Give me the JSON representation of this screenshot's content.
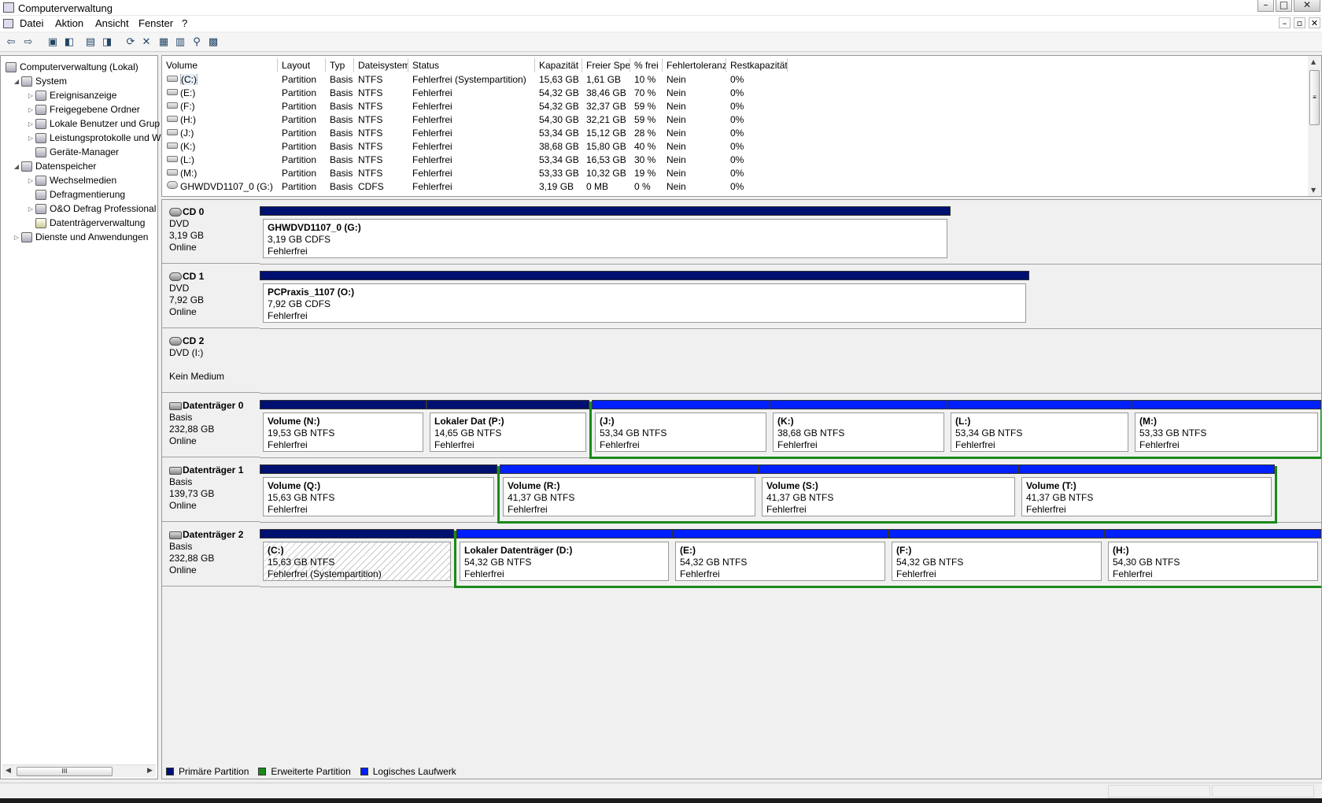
{
  "window": {
    "title": "Computerverwaltung",
    "buttons": [
      "–",
      "□",
      "✕"
    ]
  },
  "menu": {
    "items": [
      "Datei",
      "Aktion",
      "Ansicht",
      "Fenster",
      "?"
    ],
    "mdi_buttons": [
      "–",
      "▫",
      "✕"
    ]
  },
  "toolbar": {
    "buttons": [
      {
        "name": "back-icon",
        "glyph": "⇦"
      },
      {
        "name": "forward-icon",
        "glyph": "⇨"
      },
      {
        "name": "up-folder-icon",
        "glyph": "▣"
      },
      {
        "name": "show-hide-tree-icon",
        "glyph": "◧"
      },
      {
        "name": "properties-icon",
        "glyph": "▤"
      },
      {
        "name": "help-icon",
        "glyph": "◨"
      },
      {
        "name": "refresh-icon",
        "glyph": "⟳"
      },
      {
        "name": "delete-icon",
        "glyph": "✕"
      },
      {
        "name": "properties2-icon",
        "glyph": "▦"
      },
      {
        "name": "open-icon",
        "glyph": "▥"
      },
      {
        "name": "search-icon",
        "glyph": "⚲"
      },
      {
        "name": "settings-icon",
        "glyph": "▩"
      }
    ]
  },
  "tree": {
    "items": [
      {
        "label": "Computerverwaltung (Lokal)",
        "level": 0,
        "expander": ""
      },
      {
        "label": "System",
        "level": 1,
        "expander": "◢"
      },
      {
        "label": "Ereignisanzeige",
        "level": 2,
        "expander": "▷"
      },
      {
        "label": "Freigegebene Ordner",
        "level": 2,
        "expander": "▷"
      },
      {
        "label": "Lokale Benutzer und Grup",
        "level": 2,
        "expander": "▷"
      },
      {
        "label": "Leistungsprotokolle und W",
        "level": 2,
        "expander": "▷"
      },
      {
        "label": "Geräte-Manager",
        "level": 2,
        "expander": ""
      },
      {
        "label": "Datenspeicher",
        "level": 1,
        "expander": "◢"
      },
      {
        "label": "Wechselmedien",
        "level": 2,
        "expander": "▷"
      },
      {
        "label": "Defragmentierung",
        "level": 2,
        "expander": ""
      },
      {
        "label": "O&O Defrag Professional",
        "level": 2,
        "expander": "▷"
      },
      {
        "label": "Datenträgerverwaltung",
        "level": 2,
        "expander": ""
      },
      {
        "label": "Dienste und Anwendungen",
        "level": 1,
        "expander": "▷"
      }
    ],
    "scroll_thumb": "III",
    "scroll_left": "◀",
    "scroll_right": "▶"
  },
  "volumes": {
    "columns": [
      "Volume",
      "Layout",
      "Typ",
      "Dateisystem",
      "Status",
      "Kapazität",
      "Freier Speicher",
      "% frei",
      "Fehlertoleranz",
      "Restkapazität"
    ],
    "rows": [
      [
        "(C:)",
        "Partition",
        "Basis",
        "NTFS",
        "Fehlerfrei (Systempartition)",
        "15,63 GB",
        "1,61 GB",
        "10 %",
        "Nein",
        "0%"
      ],
      [
        "(E:)",
        "Partition",
        "Basis",
        "NTFS",
        "Fehlerfrei",
        "54,32 GB",
        "38,46 GB",
        "70 %",
        "Nein",
        "0%"
      ],
      [
        "(F:)",
        "Partition",
        "Basis",
        "NTFS",
        "Fehlerfrei",
        "54,32 GB",
        "32,37 GB",
        "59 %",
        "Nein",
        "0%"
      ],
      [
        "(H:)",
        "Partition",
        "Basis",
        "NTFS",
        "Fehlerfrei",
        "54,30 GB",
        "32,21 GB",
        "59 %",
        "Nein",
        "0%"
      ],
      [
        "(J:)",
        "Partition",
        "Basis",
        "NTFS",
        "Fehlerfrei",
        "53,34 GB",
        "15,12 GB",
        "28 %",
        "Nein",
        "0%"
      ],
      [
        "(K:)",
        "Partition",
        "Basis",
        "NTFS",
        "Fehlerfrei",
        "38,68 GB",
        "15,80 GB",
        "40 %",
        "Nein",
        "0%"
      ],
      [
        "(L:)",
        "Partition",
        "Basis",
        "NTFS",
        "Fehlerfrei",
        "53,34 GB",
        "16,53 GB",
        "30 %",
        "Nein",
        "0%"
      ],
      [
        "(M:)",
        "Partition",
        "Basis",
        "NTFS",
        "Fehlerfrei",
        "53,33 GB",
        "10,32 GB",
        "19 %",
        "Nein",
        "0%"
      ],
      [
        "GHWDVD1107_0 (G:)",
        "Partition",
        "Basis",
        "CDFS",
        "Fehlerfrei",
        "3,19 GB",
        "0 MB",
        "0 %",
        "Nein",
        "0%"
      ]
    ],
    "scroll_up": "▲",
    "scroll_down": "▼",
    "scroll_thumb": "≡"
  },
  "disks": [
    {
      "name": "CD 0",
      "lines": [
        "DVD",
        "3,19 GB",
        "Online"
      ]
    },
    {
      "name": "CD 1",
      "lines": [
        "DVD",
        "7,92 GB",
        "Online"
      ]
    },
    {
      "name": "CD 2",
      "lines": [
        "DVD (I:)",
        "",
        "Kein Medium"
      ]
    },
    {
      "name": "Datenträger 0",
      "lines": [
        "Basis",
        "232,88 GB",
        "Online"
      ]
    },
    {
      "name": "Datenträger 1",
      "lines": [
        "Basis",
        "139,73 GB",
        "Online"
      ]
    },
    {
      "name": "Datenträger 2",
      "lines": [
        "Basis",
        "232,88 GB",
        "Online"
      ]
    }
  ],
  "partitions": [
    {
      "name": "GHWDVD1107_0  (G:)",
      "size": "3,19 GB CDFS",
      "status": "Fehlerfrei",
      "kind": "primary"
    },
    {
      "name": "PCPraxis_1107  (O:)",
      "size": "7,92 GB CDFS",
      "status": "Fehlerfrei",
      "kind": "primary"
    },
    {
      "name": "Volume  (N:)",
      "size": "19,53 GB NTFS",
      "status": "Fehlerfrei",
      "kind": "primary"
    },
    {
      "name": "Lokaler Dat  (P:)",
      "size": "14,65 GB NTFS",
      "status": "Fehlerfrei",
      "kind": "primary"
    },
    {
      "name": "(J:)",
      "size": "53,34 GB NTFS",
      "status": "Fehlerfrei",
      "kind": "logical"
    },
    {
      "name": "(K:)",
      "size": "38,68 GB NTFS",
      "status": "Fehlerfrei",
      "kind": "logical"
    },
    {
      "name": "(L:)",
      "size": "53,34 GB NTFS",
      "status": "Fehlerfrei",
      "kind": "logical"
    },
    {
      "name": "(M:)",
      "size": "53,33 GB NTFS",
      "status": "Fehlerfrei",
      "kind": "logical"
    },
    {
      "name": "Volume  (Q:)",
      "size": "15,63 GB NTFS",
      "status": "Fehlerfrei",
      "kind": "primary"
    },
    {
      "name": "Volume  (R:)",
      "size": "41,37 GB NTFS",
      "status": "Fehlerfrei",
      "kind": "logical"
    },
    {
      "name": "Volume  (S:)",
      "size": "41,37 GB NTFS",
      "status": "Fehlerfrei",
      "kind": "logical"
    },
    {
      "name": "Volume  (T:)",
      "size": "41,37 GB NTFS",
      "status": "Fehlerfrei",
      "kind": "logical"
    },
    {
      "name": "(C:)",
      "size": "15,63 GB NTFS",
      "status": "Fehlerfrei (Systempartition)",
      "kind": "primary"
    },
    {
      "name": "Lokaler Datenträger  (D:)",
      "size": "54,32 GB NTFS",
      "status": "Fehlerfrei",
      "kind": "logical"
    },
    {
      "name": "(E:)",
      "size": "54,32 GB NTFS",
      "status": "Fehlerfrei",
      "kind": "logical"
    },
    {
      "name": "(F:)",
      "size": "54,32 GB NTFS",
      "status": "Fehlerfrei",
      "kind": "logical"
    },
    {
      "name": "(H:)",
      "size": "54,30 GB NTFS",
      "status": "Fehlerfrei",
      "kind": "logical"
    }
  ],
  "legend": {
    "primary": "Primäre Partition",
    "extended": "Erweiterte Partition",
    "logical": "Logisches Laufwerk"
  },
  "colors": {
    "primary": "#001070",
    "extended": "#1a8a1a",
    "logical": "#0020ff"
  }
}
